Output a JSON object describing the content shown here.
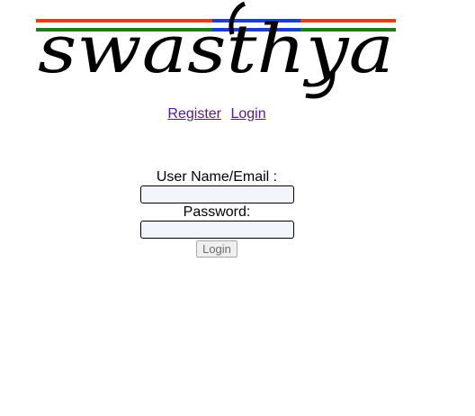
{
  "logo": {
    "text": "swasthya",
    "stripe_colors": {
      "saffron": "#ea3a16",
      "green": "#217a1e",
      "blue": "#1d3fd1"
    }
  },
  "nav": {
    "register_label": "Register",
    "login_label": "Login"
  },
  "login_form": {
    "username_label": "User Name/Email :",
    "username_value": "",
    "password_label": "Password:",
    "password_value": "",
    "submit_label": "Login"
  }
}
